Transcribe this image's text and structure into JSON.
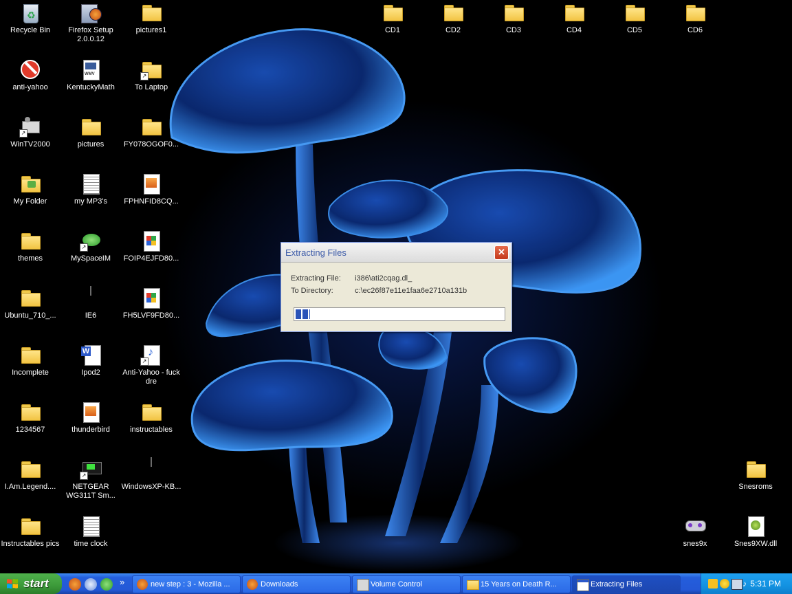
{
  "desktop": {
    "icons": [
      {
        "name": "recycle-bin-icon",
        "label": "Recycle Bin"
      },
      {
        "name": "firefox-setup-icon",
        "label": "Firefox Setup 2.0.0.12"
      },
      {
        "name": "folder-icon",
        "label": "pictures1"
      },
      {
        "name": "folder-icon",
        "label": "CD1"
      },
      {
        "name": "folder-icon",
        "label": "CD2"
      },
      {
        "name": "folder-icon",
        "label": "CD3"
      },
      {
        "name": "folder-icon",
        "label": "CD4"
      },
      {
        "name": "folder-icon",
        "label": "CD5"
      },
      {
        "name": "folder-icon",
        "label": "CD6"
      },
      {
        "name": "block-icon",
        "label": "anti-yahoo"
      },
      {
        "name": "wmv-file-icon",
        "label": "KentuckyMath"
      },
      {
        "name": "folder-shortcut-icon",
        "label": "To Laptop"
      },
      {
        "name": "tv-app-icon",
        "label": "WinTV2000"
      },
      {
        "name": "folder-icon",
        "label": "pictures"
      },
      {
        "name": "folder-icon",
        "label": "FY078OGOF0..."
      },
      {
        "name": "my-folder-icon",
        "label": "My Folder"
      },
      {
        "name": "text-file-icon",
        "label": "my MP3's"
      },
      {
        "name": "image-file-icon",
        "label": "FPHNFID8CQ..."
      },
      {
        "name": "folder-icon",
        "label": "themes"
      },
      {
        "name": "myspaceim-icon",
        "label": "MySpaceIM"
      },
      {
        "name": "image-file-icon",
        "label": "FOIP4EJFD80..."
      },
      {
        "name": "folder-icon",
        "label": "Ubuntu_710_..."
      },
      {
        "name": "window-app-icon",
        "label": "IE6"
      },
      {
        "name": "image-file-icon",
        "label": "FH5LVF9FD80..."
      },
      {
        "name": "folder-icon",
        "label": "Incomplete"
      },
      {
        "name": "word-doc-icon",
        "label": "Ipod2"
      },
      {
        "name": "mp3-file-icon",
        "label": "Anti-Yahoo - fuck dre"
      },
      {
        "name": "folder-icon",
        "label": "1234567"
      },
      {
        "name": "image-file-icon",
        "label": "thunderbird"
      },
      {
        "name": "folder-icon",
        "label": "instructables"
      },
      {
        "name": "folder-icon",
        "label": "I.Am.Legend...."
      },
      {
        "name": "netgear-app-icon",
        "label": "NETGEAR WG311T Sm..."
      },
      {
        "name": "window-app-icon",
        "label": "WindowsXP-KB..."
      },
      {
        "name": "folder-icon",
        "label": "Snesroms"
      },
      {
        "name": "folder-icon",
        "label": "Instructables pics"
      },
      {
        "name": "text-file-icon",
        "label": "time clock"
      },
      {
        "name": "snes9x-icon",
        "label": "snes9x"
      },
      {
        "name": "dll-file-icon",
        "label": "Snes9XW.dll"
      }
    ]
  },
  "dialog": {
    "title": "Extracting Files",
    "close_label": "✕",
    "file_key": "Extracting File:",
    "file_value": "i386\\ati2cqag.dl_",
    "dir_key": "To Directory:",
    "dir_value": "c:\\ec26f87e11e1faa6e2710a131b",
    "progress_fraction": 0.07
  },
  "taskbar": {
    "start_label": "start",
    "more": "»",
    "buttons": [
      {
        "label": "new step : 3 - Mozilla ..."
      },
      {
        "label": "Downloads"
      },
      {
        "label": "Volume Control"
      },
      {
        "label": "15 Years on Death R..."
      },
      {
        "label": "Extracting Files"
      }
    ],
    "clock": "5:31 PM"
  },
  "colors": {
    "taskbar_blue": "#245edc",
    "start_green": "#3c9a3a",
    "tray_blue": "#1392e1",
    "folder_yellow": "#f2c443"
  }
}
